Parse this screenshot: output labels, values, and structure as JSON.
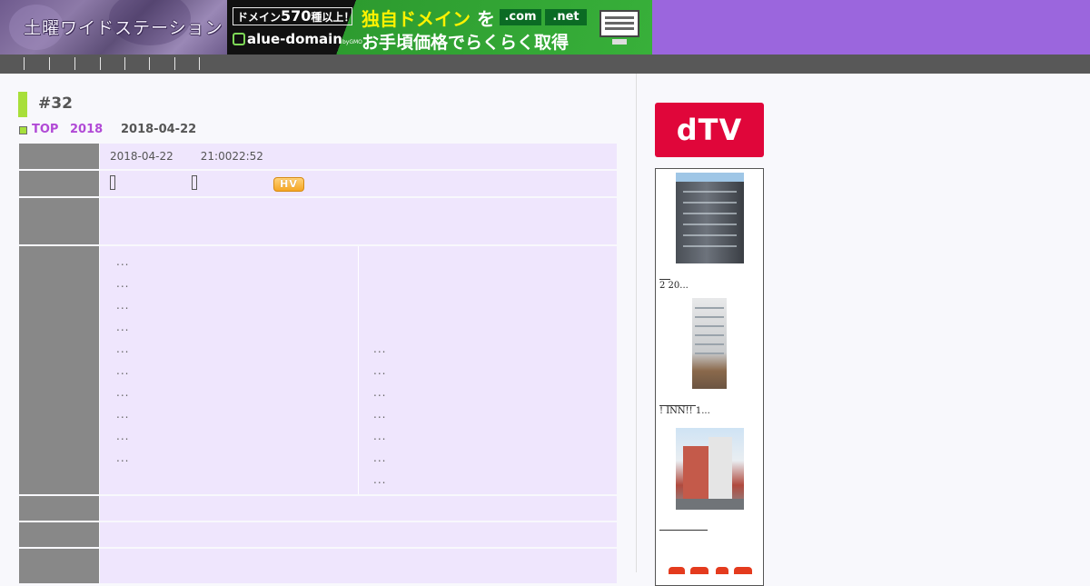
{
  "header": {
    "logo_text": "土曜ワイドステーション",
    "ad": {
      "box_text_pre": "ドメイン",
      "box_number": "570",
      "box_text_post": "種以上！",
      "brand": "alue-domain",
      "brand_suffix": "byGMO",
      "headline": "独自ドメイン",
      "headline_particle": "を",
      "tld1": ".com",
      "tld2": ".net",
      "subline": "お手頃価格でらくらく取得"
    }
  },
  "nav": {
    "separator_count": 8
  },
  "page": {
    "title": "#32",
    "breadcrumb": {
      "top": "TOP",
      "year": "2018",
      "date": "2018-04-22"
    }
  },
  "table": {
    "date": "2018-04-22",
    "time": "21:0022:52",
    "badge": "HV",
    "left_items": [
      "...",
      "...",
      "...",
      "...",
      "...",
      "...",
      "...",
      "...",
      "...",
      "..."
    ],
    "right_items": [
      "...",
      "...",
      "...",
      "...",
      "...",
      "...",
      "..."
    ]
  },
  "sidebar": {
    "dtv_label": "dTV",
    "captions": [
      "2 20...",
      "! INN!! 1..."
    ]
  },
  "colors": {
    "header_bg": "#9b66dd",
    "nav_bg": "#585858",
    "accent_green": "#a8df3a",
    "breadcrumb_link": "#b14ad6",
    "cell_bg": "#efe6fd",
    "header_cell_bg": "#888888",
    "dtv_red": "#e0063a"
  }
}
